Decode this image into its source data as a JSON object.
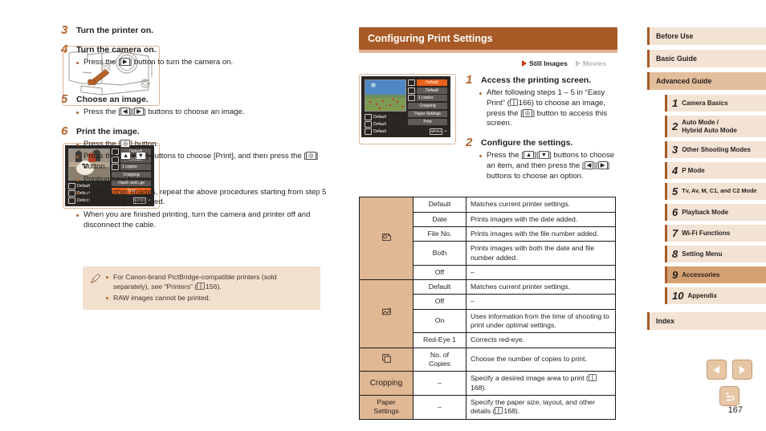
{
  "page": {
    "number": "167"
  },
  "left_column": {
    "steps": [
      {
        "num": "3",
        "title": "Turn the printer on.",
        "bullets": []
      },
      {
        "num": "4",
        "title": "Turn the camera on.",
        "bullets": [
          "Press the [▶] button to turn the camera on."
        ]
      },
      {
        "num": "5",
        "title": "Choose an image.",
        "bullets": [
          "Press the [◀][▶] buttons to choose an image."
        ]
      },
      {
        "num": "6",
        "title": "Print the image.",
        "bullets": [
          "Press the [⌘] button.",
          "Press the [▲][▼] buttons to choose [Print], and then press the [⌘] button.",
          "Printing now begins.",
          "To print other images, repeat the above procedures starting from step 5 after printing is finished.",
          "When you are finished printing, turn the camera and printer off and disconnect the cable."
        ]
      }
    ],
    "note": {
      "icon": "pencil-icon",
      "items": [
        "For Canon-brand PictBridge-compatible printers (sold separately), see “Printers” ( 156).",
        "RAW images cannot be printed."
      ]
    },
    "lcd_screen": {
      "left_items": [
        "Default",
        "Default",
        "Default"
      ],
      "right_fields": [
        "Default",
        "Default",
        "1  copies"
      ],
      "buttons": [
        "Cropping",
        "Paper Settings",
        "Print"
      ],
      "selected_button": "Print",
      "menu_tag": "MENU"
    }
  },
  "center_column": {
    "header_title": "Configuring Print Settings",
    "media_tags": [
      {
        "label": "Still Images",
        "state": "on"
      },
      {
        "label": "Movies",
        "state": "off"
      }
    ],
    "lcd_screen": {
      "left_items": [
        "Default",
        "Default",
        "Default"
      ],
      "right_fields": [
        "Default",
        "Default",
        "1  copies"
      ],
      "selected_field": "Default",
      "buttons": [
        "Cropping",
        "Paper Settings",
        "Print"
      ],
      "menu_tag": "MENU"
    },
    "steps": [
      {
        "num": "1",
        "title": "Access the printing screen.",
        "bullets": [
          "After following steps 1 – 5 in “Easy Print” ( 166) to choose an image, press the [⌘] button to access this screen."
        ]
      },
      {
        "num": "2",
        "title": "Configure the settings.",
        "bullets": [
          "Press the [▲][▼] buttons to choose an item, and then press the [◀][▶] buttons to choose an option."
        ]
      }
    ],
    "table": {
      "groups": [
        {
          "icon": "date-stamp-icon",
          "icon_glyph": "⎙",
          "rows": [
            {
              "option": "Default",
              "description": "Matches current printer settings."
            },
            {
              "option": "Date",
              "description": "Prints images with the date added."
            },
            {
              "option": "File No.",
              "description": "Prints images with the file number added."
            },
            {
              "option": "Both",
              "description": "Prints images with both the date and file number added."
            },
            {
              "option": "Off",
              "description": "–"
            }
          ]
        },
        {
          "icon": "image-optimize-icon",
          "icon_glyph": "✐",
          "rows": [
            {
              "option": "Default",
              "description": "Matches current printer settings."
            },
            {
              "option": "Off",
              "description": "–"
            },
            {
              "option": "On",
              "description": "Uses information from the time of shooting to print under optimal settings."
            },
            {
              "option": "Red-Eye 1",
              "description": "Corrects red-eye."
            }
          ]
        },
        {
          "icon": "copies-icon",
          "icon_glyph": "⧉",
          "rows": [
            {
              "option": "No. of\nCopies",
              "description": "Choose the number of copies to print."
            }
          ]
        }
      ],
      "plain_rows": [
        {
          "label": "Cropping",
          "option": "–",
          "description": "Specify a desired image area to print ( 168)."
        },
        {
          "label": "Paper\nSettings",
          "option": "–",
          "description": "Specify the paper size, layout, and other details ( 168)."
        }
      ]
    }
  },
  "sidebar": {
    "top_items": [
      {
        "label": "Before Use",
        "active": false
      },
      {
        "label": "Basic Guide",
        "active": false
      },
      {
        "label": "Advanced Guide",
        "active": true
      }
    ],
    "chapters": [
      {
        "num": "1",
        "label": "Camera Basics",
        "active": false
      },
      {
        "num": "2",
        "label": "Auto Mode /\nHybrid Auto Mode",
        "active": false
      },
      {
        "num": "3",
        "label": "Other Shooting Modes",
        "active": false
      },
      {
        "num": "4",
        "label": "P Mode",
        "active": false
      },
      {
        "num": "5",
        "label": "Tv, Av, M, C1, and C2 Mode",
        "active": false
      },
      {
        "num": "6",
        "label": "Playback Mode",
        "active": false
      },
      {
        "num": "7",
        "label": "Wi-Fi Functions",
        "active": false
      },
      {
        "num": "8",
        "label": "Setting Menu",
        "active": false
      },
      {
        "num": "9",
        "label": "Accessories",
        "active": true
      },
      {
        "num": "10",
        "label": "Appendix",
        "active": false
      }
    ],
    "index": {
      "label": "Index",
      "active": false
    }
  },
  "pager": {
    "prev_icon": "left-arrow-icon",
    "next_icon": "right-arrow-icon",
    "home_icon": "return-home-icon"
  },
  "colors": {
    "accent_brown": "#a85a26",
    "tan": "#e0b894",
    "light_tan": "#f3e3d4",
    "active_chapter": "#d5a173",
    "note_bg": "#f3dfcd",
    "lcd_select": "#e8621d"
  }
}
